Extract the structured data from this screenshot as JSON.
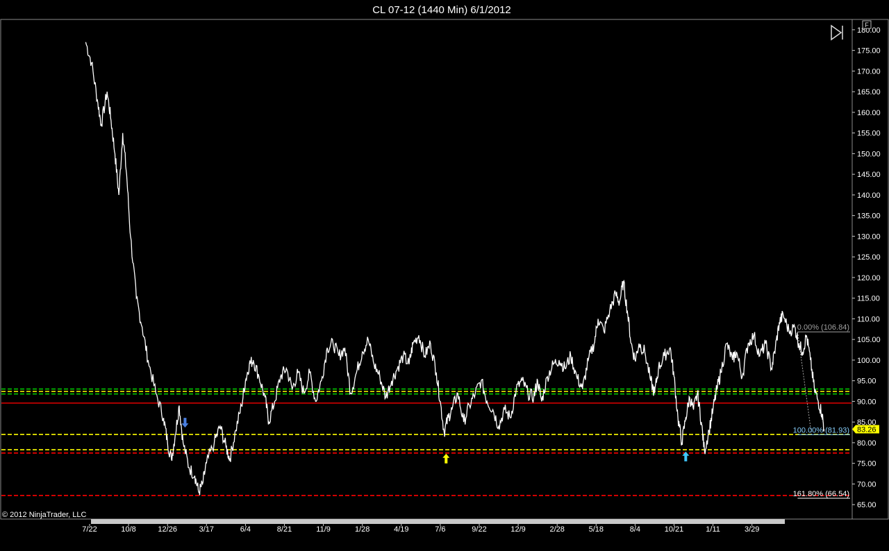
{
  "window": {
    "title": "CL 07-12 (1440 Min)  6/1/2012",
    "copyright": "© 2012 NinjaTrader, LLC",
    "panel_button": "F"
  },
  "chart_data": {
    "type": "line",
    "title": "CL 07-12 (1440 Min)  6/1/2012",
    "background": "#000000",
    "price_color": "#ffffff",
    "ylim": [
      61.5,
      182.5
    ],
    "yticks": [
      180,
      175,
      170,
      165,
      160,
      155,
      150,
      145,
      140,
      135,
      130,
      125,
      120,
      115,
      110,
      105,
      100,
      95,
      90,
      85,
      80,
      75,
      70,
      65
    ],
    "xticks": [
      "7/22",
      "10/8",
      "12/26",
      "3/17",
      "6/4",
      "8/21",
      "11/9",
      "1/28",
      "4/19",
      "7/6",
      "9/22",
      "12/9",
      "2/28",
      "5/18",
      "8/4",
      "10/21",
      "1/11",
      "3/29"
    ],
    "x_range_ticks": [
      -1.0,
      18.3
    ],
    "series": [
      {
        "points": [
          [
            -0.1,
            177.0
          ],
          [
            0.05,
            172.0
          ],
          [
            0.2,
            163.0
          ],
          [
            0.3,
            157.0
          ],
          [
            0.45,
            165.0
          ],
          [
            0.55,
            158.0
          ],
          [
            0.65,
            150.0
          ],
          [
            0.75,
            140.0
          ],
          [
            0.85,
            155.0
          ],
          [
            0.95,
            145.0
          ],
          [
            1.05,
            130.0
          ],
          [
            1.2,
            115.0
          ],
          [
            1.35,
            108.0
          ],
          [
            1.5,
            100.0
          ],
          [
            1.7,
            92.0
          ],
          [
            1.9,
            86.0
          ],
          [
            2.0,
            80.0
          ],
          [
            2.1,
            76.0
          ],
          [
            2.2,
            82.0
          ],
          [
            2.3,
            89.0
          ],
          [
            2.4,
            80.0
          ],
          [
            2.55,
            74.0
          ],
          [
            2.7,
            72.0
          ],
          [
            2.8,
            68.0
          ],
          [
            2.9,
            70.0
          ],
          [
            3.0,
            75.0
          ],
          [
            3.2,
            80.0
          ],
          [
            3.35,
            84.0
          ],
          [
            3.5,
            79.0
          ],
          [
            3.6,
            76.0
          ],
          [
            3.75,
            83.0
          ],
          [
            3.9,
            89.0
          ],
          [
            4.0,
            95.0
          ],
          [
            4.1,
            99.0
          ],
          [
            4.2,
            100.0
          ],
          [
            4.35,
            96.0
          ],
          [
            4.5,
            91.0
          ],
          [
            4.6,
            85.0
          ],
          [
            4.75,
            90.0
          ],
          [
            4.9,
            96.0
          ],
          [
            5.05,
            98.0
          ],
          [
            5.2,
            93.0
          ],
          [
            5.35,
            97.0
          ],
          [
            5.5,
            92.0
          ],
          [
            5.65,
            97.0
          ],
          [
            5.8,
            90.0
          ],
          [
            5.95,
            95.0
          ],
          [
            6.1,
            103.0
          ],
          [
            6.25,
            104.0
          ],
          [
            6.4,
            101.0
          ],
          [
            6.55,
            103.0
          ],
          [
            6.7,
            92.0
          ],
          [
            6.85,
            97.0
          ],
          [
            7.0,
            102.0
          ],
          [
            7.15,
            105.0
          ],
          [
            7.3,
            99.0
          ],
          [
            7.45,
            96.0
          ],
          [
            7.6,
            91.0
          ],
          [
            7.75,
            95.0
          ],
          [
            7.9,
            98.0
          ],
          [
            8.05,
            101.0
          ],
          [
            8.2,
            99.0
          ],
          [
            8.3,
            104.0
          ],
          [
            8.45,
            106.0
          ],
          [
            8.6,
            101.0
          ],
          [
            8.75,
            104.0
          ],
          [
            8.9,
            97.0
          ],
          [
            9.0,
            90.0
          ],
          [
            9.1,
            82.5
          ],
          [
            9.2,
            86.0
          ],
          [
            9.3,
            88.0
          ],
          [
            9.45,
            92.0
          ],
          [
            9.6,
            85.0
          ],
          [
            9.75,
            89.0
          ],
          [
            9.9,
            92.0
          ],
          [
            10.05,
            95.0
          ],
          [
            10.2,
            90.0
          ],
          [
            10.35,
            88.0
          ],
          [
            10.5,
            84.0
          ],
          [
            10.65,
            88.0
          ],
          [
            10.8,
            86.0
          ],
          [
            10.95,
            93.0
          ],
          [
            11.1,
            95.0
          ],
          [
            11.25,
            92.0
          ],
          [
            11.4,
            91.0
          ],
          [
            11.5,
            95.0
          ],
          [
            11.6,
            90.0
          ],
          [
            11.75,
            96.0
          ],
          [
            11.9,
            99.0
          ],
          [
            12.05,
            100.0
          ],
          [
            12.2,
            98.0
          ],
          [
            12.35,
            101.0
          ],
          [
            12.5,
            96.0
          ],
          [
            12.65,
            93.0
          ],
          [
            12.8,
            100.0
          ],
          [
            12.95,
            104.0
          ],
          [
            13.05,
            110.0
          ],
          [
            13.2,
            107.0
          ],
          [
            13.35,
            112.0
          ],
          [
            13.5,
            116.0
          ],
          [
            13.6,
            114.0
          ],
          [
            13.7,
            119.0
          ],
          [
            13.8,
            112.0
          ],
          [
            13.9,
            104.0
          ],
          [
            14.0,
            100.0
          ],
          [
            14.1,
            104.0
          ],
          [
            14.25,
            102.0
          ],
          [
            14.4,
            95.0
          ],
          [
            14.5,
            92.0
          ],
          [
            14.6,
            98.0
          ],
          [
            14.75,
            101.0
          ],
          [
            14.9,
            103.0
          ],
          [
            15.0,
            96.0
          ],
          [
            15.1,
            86.0
          ],
          [
            15.2,
            80.0
          ],
          [
            15.3,
            86.0
          ],
          [
            15.4,
            91.0
          ],
          [
            15.5,
            88.0
          ],
          [
            15.6,
            92.0
          ],
          [
            15.7,
            85.0
          ],
          [
            15.78,
            78.0
          ],
          [
            15.9,
            83.0
          ],
          [
            16.0,
            88.0
          ],
          [
            16.1,
            93.0
          ],
          [
            16.2,
            97.0
          ],
          [
            16.35,
            104.0
          ],
          [
            16.5,
            100.0
          ],
          [
            16.6,
            102.0
          ],
          [
            16.75,
            96.0
          ],
          [
            16.9,
            104.0
          ],
          [
            17.05,
            106.0
          ],
          [
            17.2,
            101.0
          ],
          [
            17.35,
            104.0
          ],
          [
            17.5,
            98.0
          ],
          [
            17.6,
            103.0
          ],
          [
            17.7,
            109.0
          ],
          [
            17.8,
            111.0
          ],
          [
            17.95,
            107.0
          ],
          [
            18.1,
            108.0
          ],
          [
            18.2,
            104.0
          ],
          [
            18.3,
            102.0
          ],
          [
            18.4,
            106.0
          ],
          [
            18.5,
            100.0
          ],
          [
            18.6,
            93.0
          ],
          [
            18.7,
            90.0
          ],
          [
            18.8,
            87.0
          ],
          [
            18.85,
            83.26
          ]
        ]
      }
    ],
    "last_price": {
      "value": 83.26,
      "label": "83.26",
      "color": "#ffff00"
    },
    "horizontal_lines": [
      {
        "price": 93.0,
        "color": "#00c800",
        "style": "dashed"
      },
      {
        "price": 92.4,
        "color": "#ffff00",
        "style": "dashed"
      },
      {
        "price": 91.8,
        "color": "#00c800",
        "style": "dashed"
      },
      {
        "price": 89.6,
        "color": "#d00000",
        "style": "solid"
      },
      {
        "price": 82.0,
        "color": "#ffff00",
        "style": "dashed"
      },
      {
        "price": 78.3,
        "color": "#ffff00",
        "style": "dashed"
      },
      {
        "price": 77.5,
        "color": "#ff0000",
        "style": "dashed"
      },
      {
        "price": 67.2,
        "color": "#ff0000",
        "style": "dashed"
      }
    ],
    "fibonacci": {
      "levels": [
        {
          "label": "0.00% (106.84)",
          "price": 106.84,
          "color": "#a0a0a0"
        },
        {
          "label": "100.00% (81.93)",
          "price": 81.93,
          "color": "#87cefa"
        },
        {
          "label": "161.80% (66.54)",
          "price": 66.54,
          "color": "#ffffff"
        }
      ],
      "anchor_x": [
        18.35,
        18.85
      ]
    },
    "markers": [
      {
        "x": 2.45,
        "price": 84.0,
        "direction": "down",
        "color": "#4a7fe0"
      },
      {
        "x": 9.15,
        "price": 77.0,
        "direction": "up",
        "color": "#ffff00"
      },
      {
        "x": 15.3,
        "price": 77.5,
        "direction": "up",
        "color": "#40c8ff"
      }
    ]
  }
}
